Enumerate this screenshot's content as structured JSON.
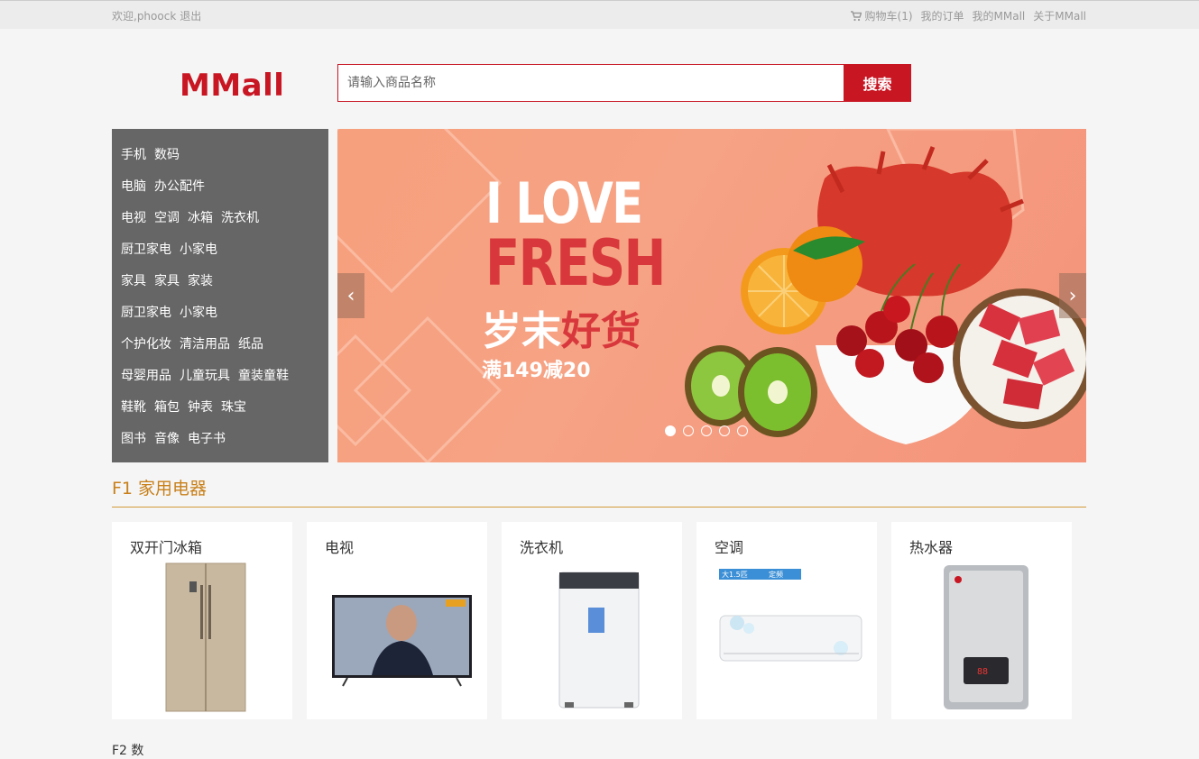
{
  "topbar": {
    "welcome": "欢迎,phoock",
    "logout": "退出",
    "cart": "购物车(1)",
    "orders": "我的订单",
    "my_mall": "我的MMall",
    "about": "关于MMall"
  },
  "logo": "MMall",
  "search": {
    "placeholder": "请输入商品名称",
    "button": "搜索"
  },
  "categories": [
    [
      "手机",
      "数码"
    ],
    [
      "电脑",
      "办公配件"
    ],
    [
      "电视",
      "空调",
      "冰箱",
      "洗衣机"
    ],
    [
      "厨卫家电",
      "小家电"
    ],
    [
      "家具",
      "家具",
      "家装"
    ],
    [
      "厨卫家电",
      "小家电"
    ],
    [
      "个护化妆",
      "清洁用品",
      "纸品"
    ],
    [
      "母婴用品",
      "儿童玩具",
      "童装童鞋"
    ],
    [
      "鞋靴",
      "箱包",
      "钟表",
      "珠宝"
    ],
    [
      "图书",
      "音像",
      "电子书"
    ]
  ],
  "banner": {
    "line1": "I LOVE",
    "line2": "FRESH",
    "line3_white": "岁末",
    "line3_red": "好货",
    "line4": "满149减20",
    "active_slide": 1,
    "slide_count": 5,
    "colors": {
      "background": "#f6a284",
      "accent": "#d8383c"
    }
  },
  "floor": {
    "title": "F1 家用电器",
    "products": [
      {
        "name": "双开门冰箱",
        "icon": "fridge-icon"
      },
      {
        "name": "电视",
        "icon": "tv-icon"
      },
      {
        "name": "洗衣机",
        "icon": "washer-icon"
      },
      {
        "name": "空调",
        "icon": "air-conditioner-icon",
        "tags": [
          "大1.5匹",
          "定频"
        ]
      },
      {
        "name": "热水器",
        "icon": "water-heater-icon"
      }
    ]
  },
  "next_floor_peek": "F2 数"
}
